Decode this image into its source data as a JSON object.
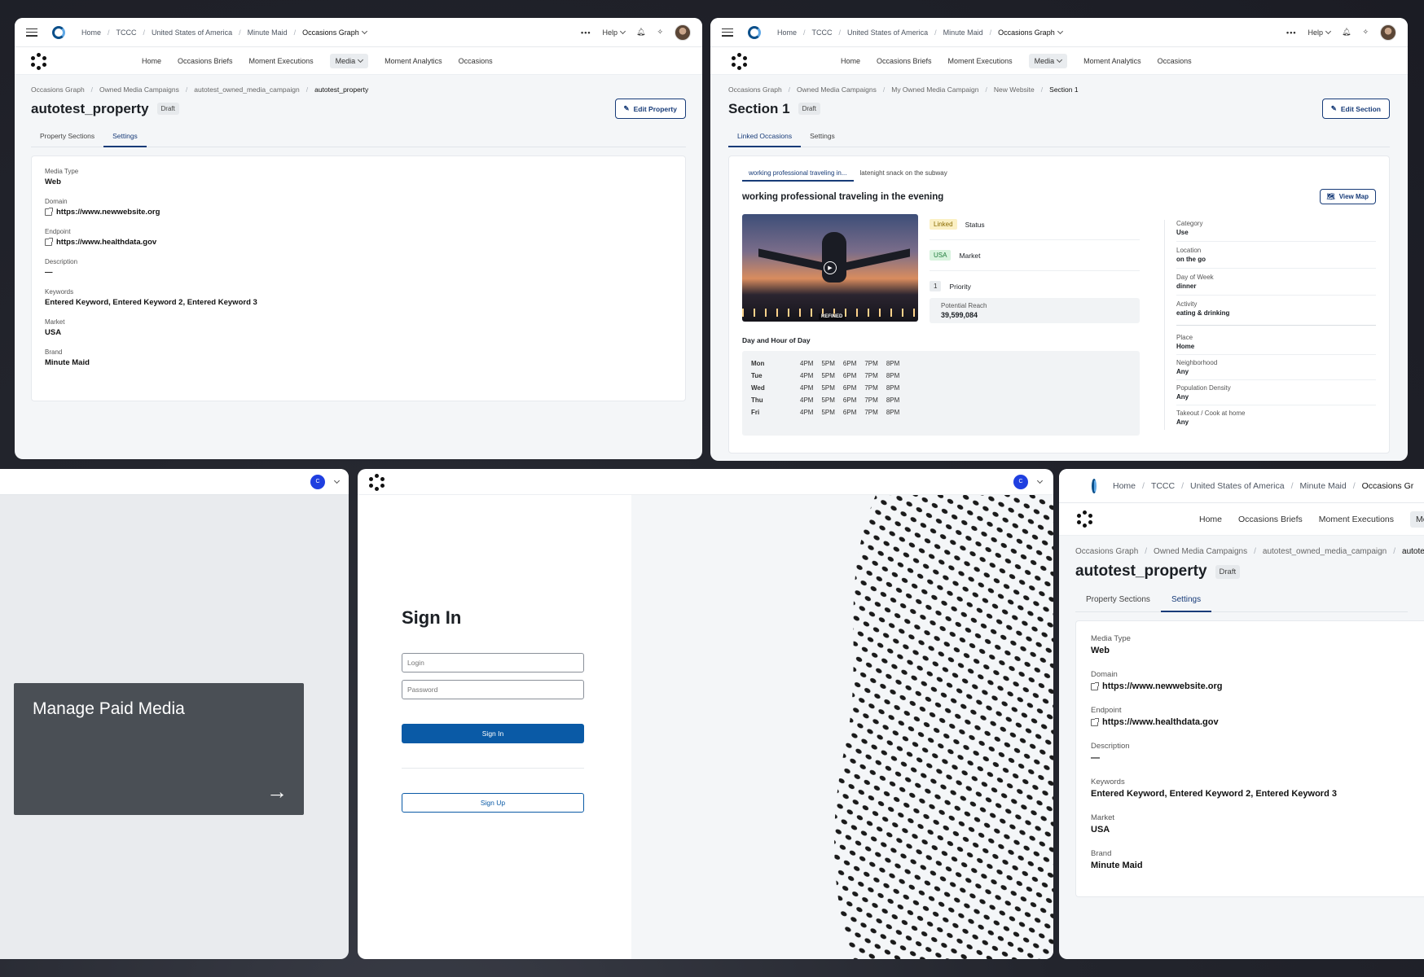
{
  "nav": {
    "breadcrumbs": [
      "Home",
      "TCCC",
      "United States of America",
      "Minute Maid",
      "Occasions Graph"
    ],
    "help": "Help",
    "tabs": [
      "Home",
      "Occasions Briefs",
      "Moment Executions",
      "Media",
      "Moment Analytics",
      "Occasions"
    ]
  },
  "property_panel": {
    "breadcrumbs": [
      "Occasions Graph",
      "Owned Media Campaigns",
      "autotest_owned_media_campaign",
      "autotest_property"
    ],
    "title": "autotest_property",
    "badge": "Draft",
    "edit_button": "Edit Property",
    "tabs": [
      "Property Sections",
      "Settings"
    ],
    "fields": [
      {
        "label": "Media Type",
        "value": "Web"
      },
      {
        "label": "Domain",
        "value": "https://www.newwebsite.org",
        "link": true
      },
      {
        "label": "Endpoint",
        "value": "https://www.healthdata.gov",
        "link": true
      },
      {
        "label": "Description",
        "value": "—"
      },
      {
        "label": "Keywords",
        "value": "Entered Keyword, Entered Keyword 2, Entered Keyword 3"
      },
      {
        "label": "Market",
        "value": "USA"
      },
      {
        "label": "Brand",
        "value": "Minute Maid"
      }
    ]
  },
  "section_panel": {
    "breadcrumbs": [
      "Occasions Graph",
      "Owned Media Campaigns",
      "My Owned Media Campaign",
      "New Website",
      "Section 1"
    ],
    "title": "Section 1",
    "badge": "Draft",
    "edit_button": "Edit Section",
    "tabs": [
      "Linked Occasions",
      "Settings"
    ],
    "occasion_tabs": [
      "working professional traveling in...",
      "latenight snack on the subway"
    ],
    "occasion_title": "working professional traveling in the evening",
    "view_map": "View Map",
    "image_tag": "REFINED",
    "status": {
      "chip": "Linked",
      "label": "Status"
    },
    "market": {
      "chip": "USA",
      "label": "Market"
    },
    "priority": {
      "chip": "1",
      "label": "Priority"
    },
    "reach": {
      "label": "Potential Reach",
      "value": "39,599,084"
    },
    "schedule_title": "Day and Hour of Day",
    "schedule": [
      {
        "day": "Mon",
        "hours": [
          "4PM",
          "5PM",
          "6PM",
          "7PM",
          "8PM"
        ]
      },
      {
        "day": "Tue",
        "hours": [
          "4PM",
          "5PM",
          "6PM",
          "7PM",
          "8PM"
        ]
      },
      {
        "day": "Wed",
        "hours": [
          "4PM",
          "5PM",
          "6PM",
          "7PM",
          "8PM"
        ]
      },
      {
        "day": "Thu",
        "hours": [
          "4PM",
          "5PM",
          "6PM",
          "7PM",
          "8PM"
        ]
      },
      {
        "day": "Fri",
        "hours": [
          "4PM",
          "5PM",
          "6PM",
          "7PM",
          "8PM"
        ]
      }
    ],
    "attrs1": [
      {
        "label": "Category",
        "value": "Use"
      },
      {
        "label": "Location",
        "value": "on the go"
      },
      {
        "label": "Day of Week",
        "value": "dinner"
      },
      {
        "label": "Activity",
        "value": "eating & drinking"
      }
    ],
    "attrs2": [
      {
        "label": "Place",
        "value": "Home"
      },
      {
        "label": "Neighborhood",
        "value": "Any"
      },
      {
        "label": "Population Density",
        "value": "Any"
      },
      {
        "label": "Takeout / Cook at home",
        "value": "Any"
      }
    ]
  },
  "paid_media": {
    "user_initial": "C",
    "card_title": "Manage Paid Media"
  },
  "signin": {
    "user_initial": "C",
    "title": "Sign In",
    "login_placeholder": "Login",
    "password_placeholder": "Password",
    "signin_button": "Sign In",
    "signup_button": "Sign Up"
  },
  "zoom_panel": {
    "breadcrumbs": [
      "Home",
      "TCCC",
      "United States of America",
      "Minute Maid",
      "Occasions Gr"
    ],
    "tabs": [
      "Home",
      "Occasions Briefs",
      "Moment Executions",
      "Media"
    ],
    "breadcrumbs2": [
      "Occasions Graph",
      "Owned Media Campaigns",
      "autotest_owned_media_campaign",
      "autotes"
    ]
  },
  "colors": {
    "accent": "#173b78",
    "signin_blue": "#0a5aa6",
    "card_dark": "#4a4f55"
  }
}
